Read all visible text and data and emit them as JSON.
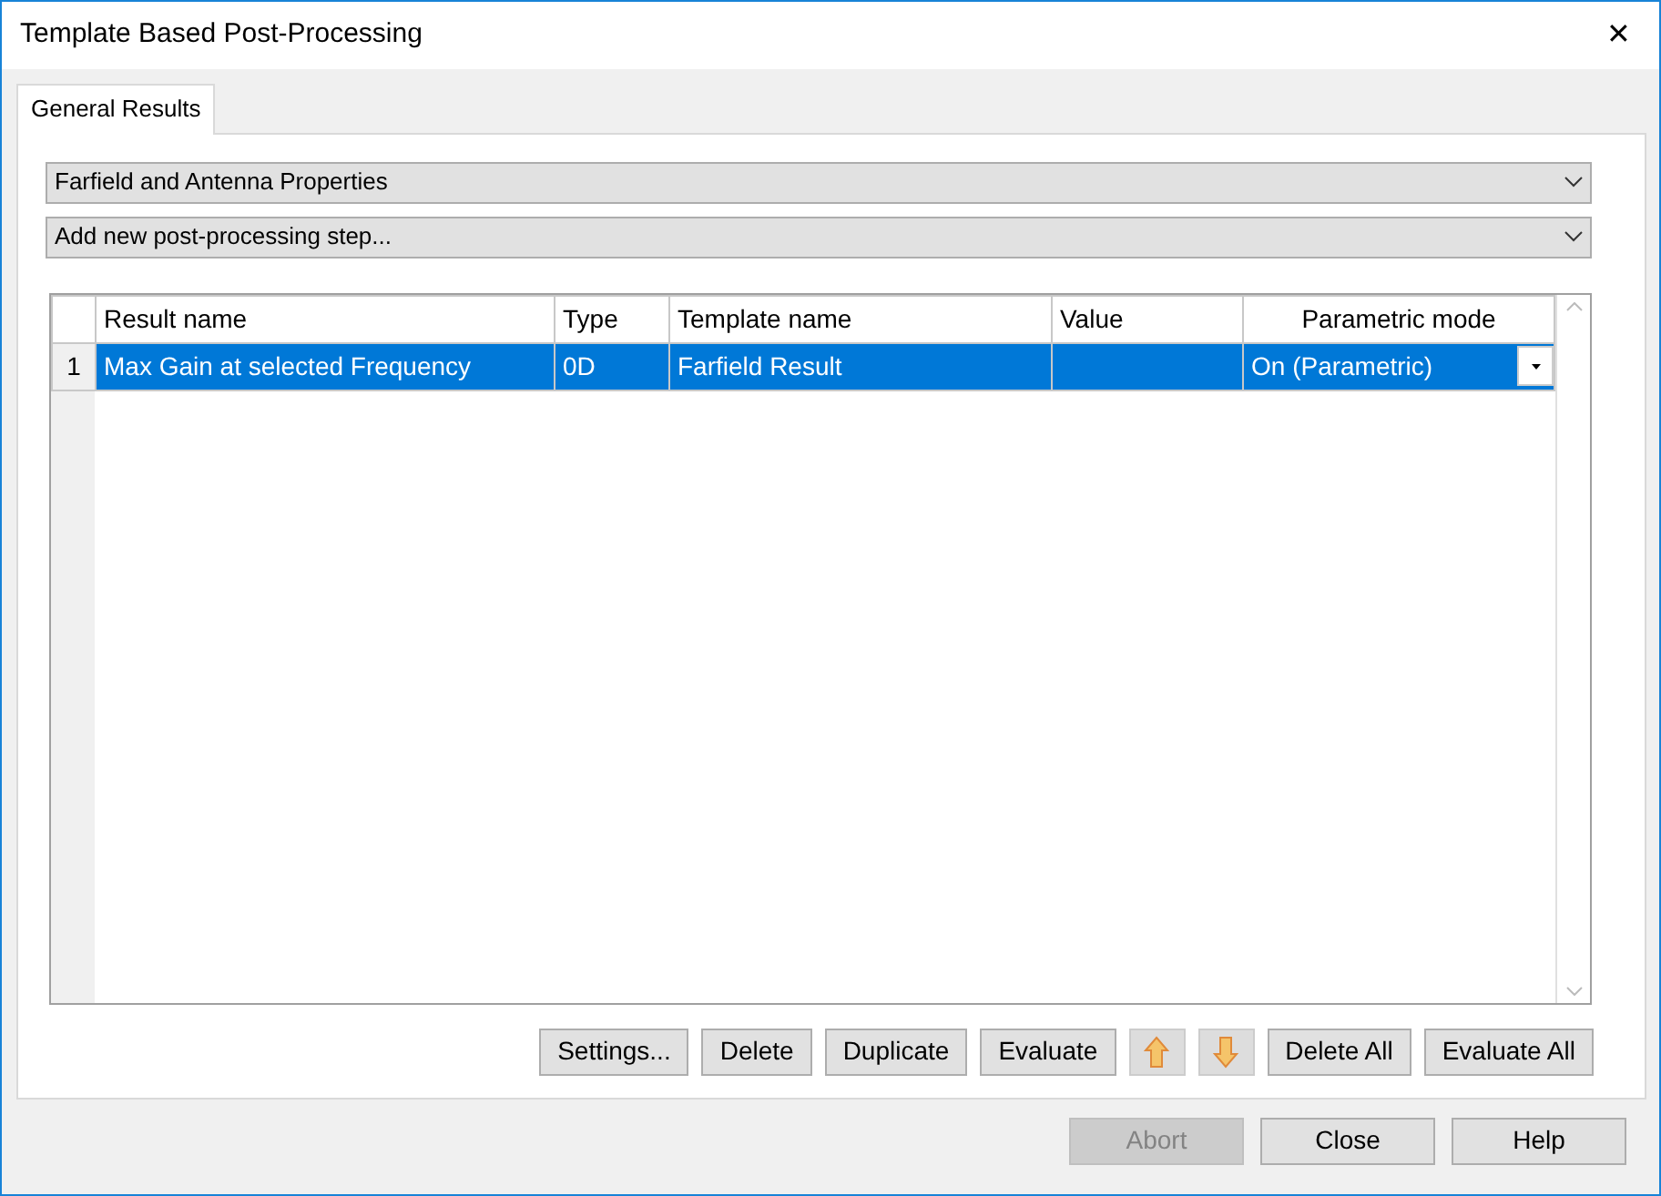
{
  "window": {
    "title": "Template Based Post-Processing",
    "close": "✕"
  },
  "tabs": [
    {
      "label": "General Results",
      "selected": true
    }
  ],
  "dropdowns": [
    {
      "value": "Farfield and Antenna Properties"
    },
    {
      "value": "Add new post-processing step..."
    }
  ],
  "table": {
    "columns": [
      "Result name",
      "Type",
      "Template name",
      "Value",
      "Parametric mode"
    ],
    "rows": [
      {
        "number": "1",
        "selected": true,
        "cells": [
          "Max Gain at selected Frequency",
          "0D",
          "Farfield Result",
          "",
          "On (Parametric)"
        ]
      }
    ]
  },
  "actions": [
    {
      "kind": "text",
      "label": "Settings..."
    },
    {
      "kind": "text",
      "label": "Delete"
    },
    {
      "kind": "text",
      "label": "Duplicate"
    },
    {
      "kind": "text",
      "label": "Evaluate"
    },
    {
      "kind": "up"
    },
    {
      "kind": "down"
    },
    {
      "kind": "text",
      "label": "Delete All"
    },
    {
      "kind": "text",
      "label": "Evaluate All"
    }
  ],
  "footer": [
    {
      "label": "Abort",
      "disabled": true
    },
    {
      "label": "Close",
      "disabled": false
    },
    {
      "label": "Help",
      "disabled": false
    }
  ]
}
